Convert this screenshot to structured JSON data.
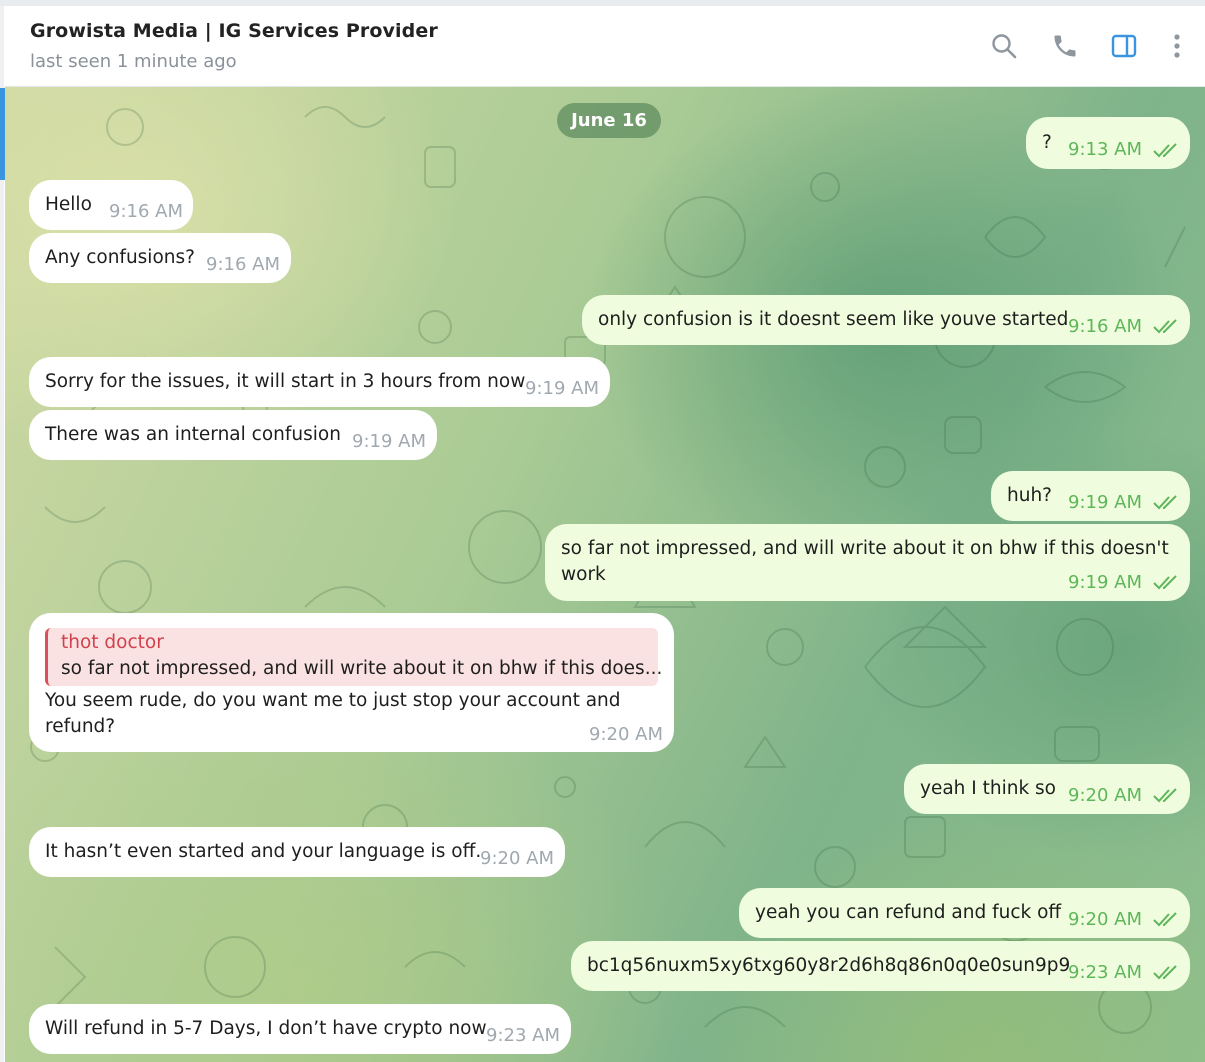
{
  "header": {
    "title": "Growista Media | IG Services Provider",
    "status": "last seen 1 minute ago",
    "icons": [
      "search-icon",
      "phone-icon",
      "sidebar-toggle-icon",
      "more-vert-icon"
    ]
  },
  "colors": {
    "accent": "#3a95e0",
    "outgoing_bubble": "#effdde",
    "incoming_bubble": "#ffffff",
    "read_ticks": "#5fb65a",
    "reply_name": "#d0414d"
  },
  "date_label": "June 16",
  "messages": [
    {
      "dir": "out",
      "text": "?",
      "time": "9:13 AM"
    },
    {
      "dir": "in",
      "text": "Hello",
      "time": "9:16 AM"
    },
    {
      "dir": "in",
      "text": "Any confusions?",
      "time": "9:16 AM"
    },
    {
      "dir": "out",
      "text": "only confusion is it doesnt seem like youve started",
      "time": "9:16 AM"
    },
    {
      "dir": "in",
      "text": "Sorry for the issues, it will start in 3 hours from now",
      "time": "9:19 AM"
    },
    {
      "dir": "in",
      "text": "There was an internal confusion",
      "time": "9:19 AM"
    },
    {
      "dir": "out",
      "text": "huh?",
      "time": "9:19 AM"
    },
    {
      "dir": "out",
      "text_line1": "so far not impressed, and will write about it on bhw if this doesn't",
      "text_line2": "work",
      "time": "9:19 AM"
    },
    {
      "dir": "in",
      "reply_name": "thot doctor",
      "reply_text": "so far not impressed, and will write about it on bhw if this does...",
      "text_line1": "You seem rude, do you want me to just stop your account and",
      "text_line2": "refund?",
      "time": "9:20 AM"
    },
    {
      "dir": "out",
      "text": "yeah I think so",
      "time": "9:20 AM"
    },
    {
      "dir": "in",
      "text": "It hasn’t even started and your language is off.",
      "time": "9:20 AM"
    },
    {
      "dir": "out",
      "text": "yeah you can refund and fuck off",
      "time": "9:20 AM"
    },
    {
      "dir": "out",
      "text": "bc1q56nuxm5xy6txg60y8r2d6h8q86n0q0e0sun9p9",
      "time": "9:23 AM"
    },
    {
      "dir": "in",
      "text": "Will refund in 5-7 Days, I don’t have crypto now",
      "time": "9:23 AM"
    }
  ]
}
